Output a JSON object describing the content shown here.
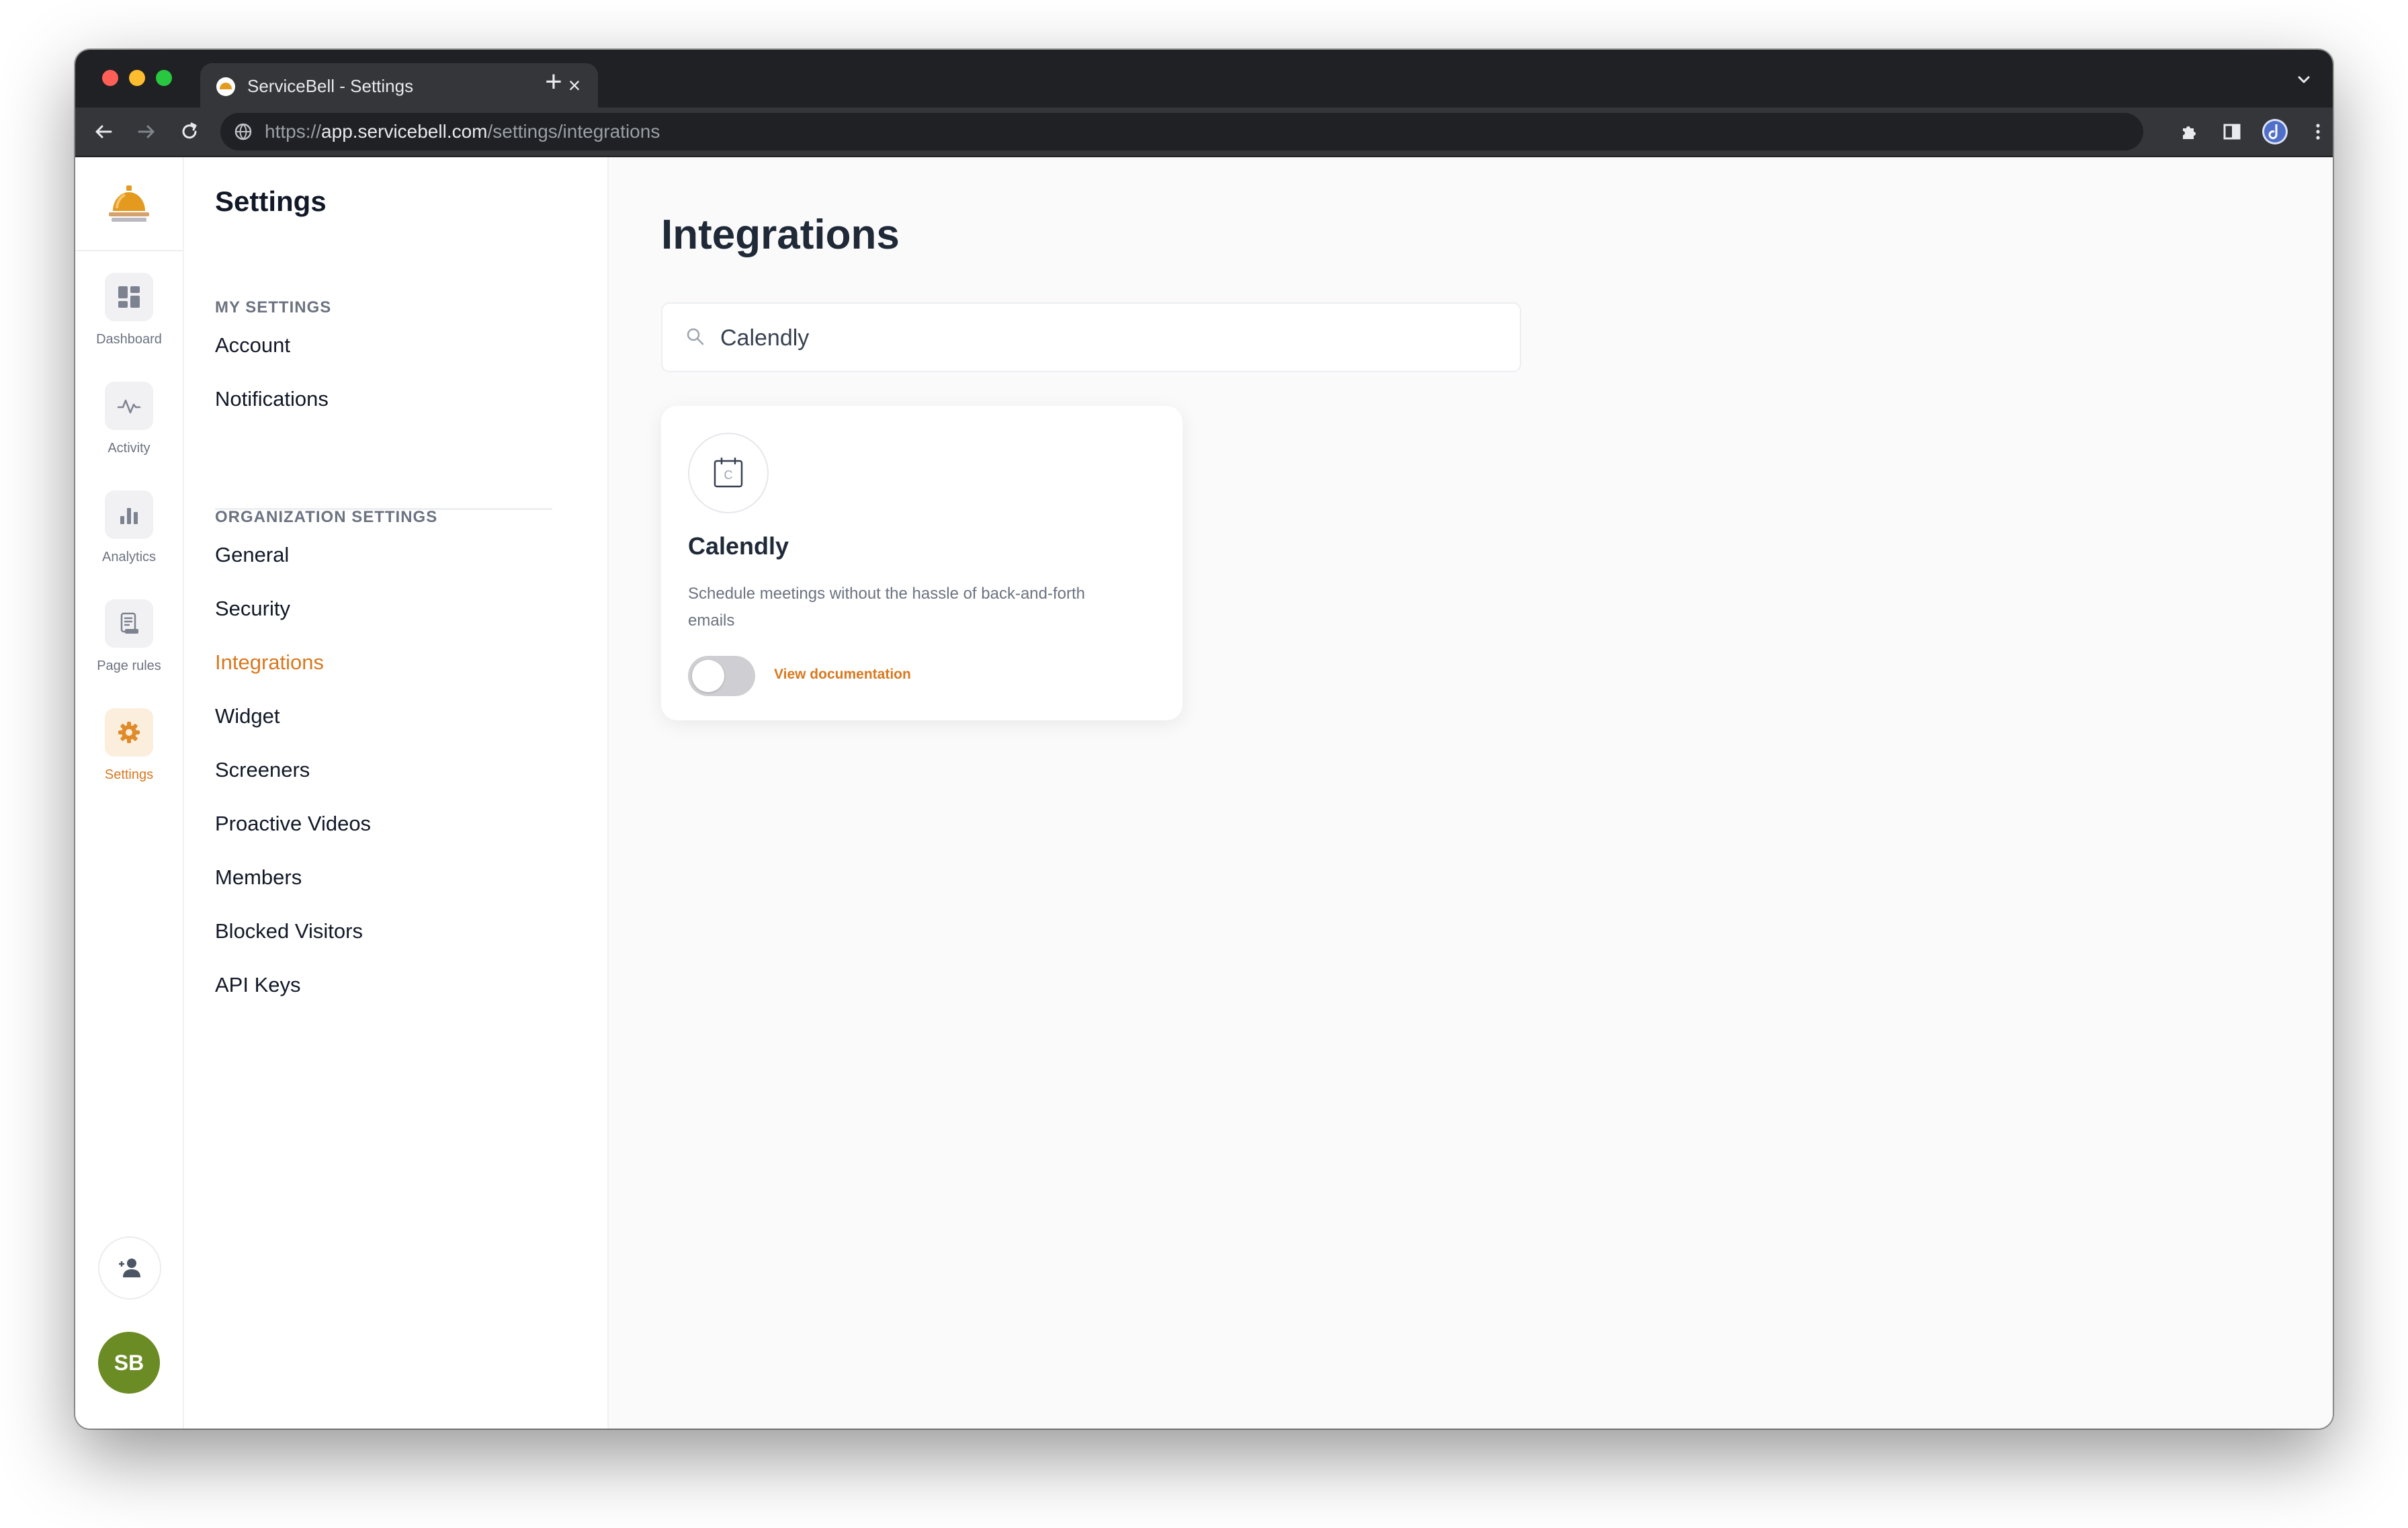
{
  "browser": {
    "tab_title": "ServiceBell - Settings",
    "tab_close": "×",
    "new_tab": "+",
    "url_scheme": "https://",
    "url_host": "app.servicebell.com",
    "url_path": "/settings/integrations"
  },
  "iconbar": {
    "items": [
      {
        "label": "Dashboard",
        "icon": "dashboard-icon",
        "active": false
      },
      {
        "label": "Activity",
        "icon": "activity-icon",
        "active": false
      },
      {
        "label": "Analytics",
        "icon": "analytics-icon",
        "active": false
      },
      {
        "label": "Page rules",
        "icon": "page-rules-icon",
        "active": false
      },
      {
        "label": "Settings",
        "icon": "gear-icon",
        "active": true
      }
    ],
    "avatar_initials": "SB",
    "avatar_color": "#6b8b24"
  },
  "settings_nav": {
    "title": "Settings",
    "my_settings_heading": "MY SETTINGS",
    "my_settings": [
      "Account",
      "Notifications"
    ],
    "org_settings_heading": "ORGANIZATION SETTINGS",
    "org_settings": [
      "General",
      "Security",
      "Integrations",
      "Widget",
      "Screeners",
      "Proactive Videos",
      "Members",
      "Blocked Visitors",
      "API Keys"
    ],
    "active_item": "Integrations"
  },
  "main": {
    "page_title": "Integrations",
    "search_value": "Calendly",
    "cards": [
      {
        "icon_letter": "C",
        "title": "Calendly",
        "description": "Schedule meetings without the hassle of back-and-forth emails",
        "enabled": false,
        "doc_link": "View documentation"
      }
    ]
  },
  "colors": {
    "accent": "#d9781f",
    "text_primary": "#111827",
    "text_muted": "#6b7280",
    "toggle_off": "#cfcfd3"
  }
}
